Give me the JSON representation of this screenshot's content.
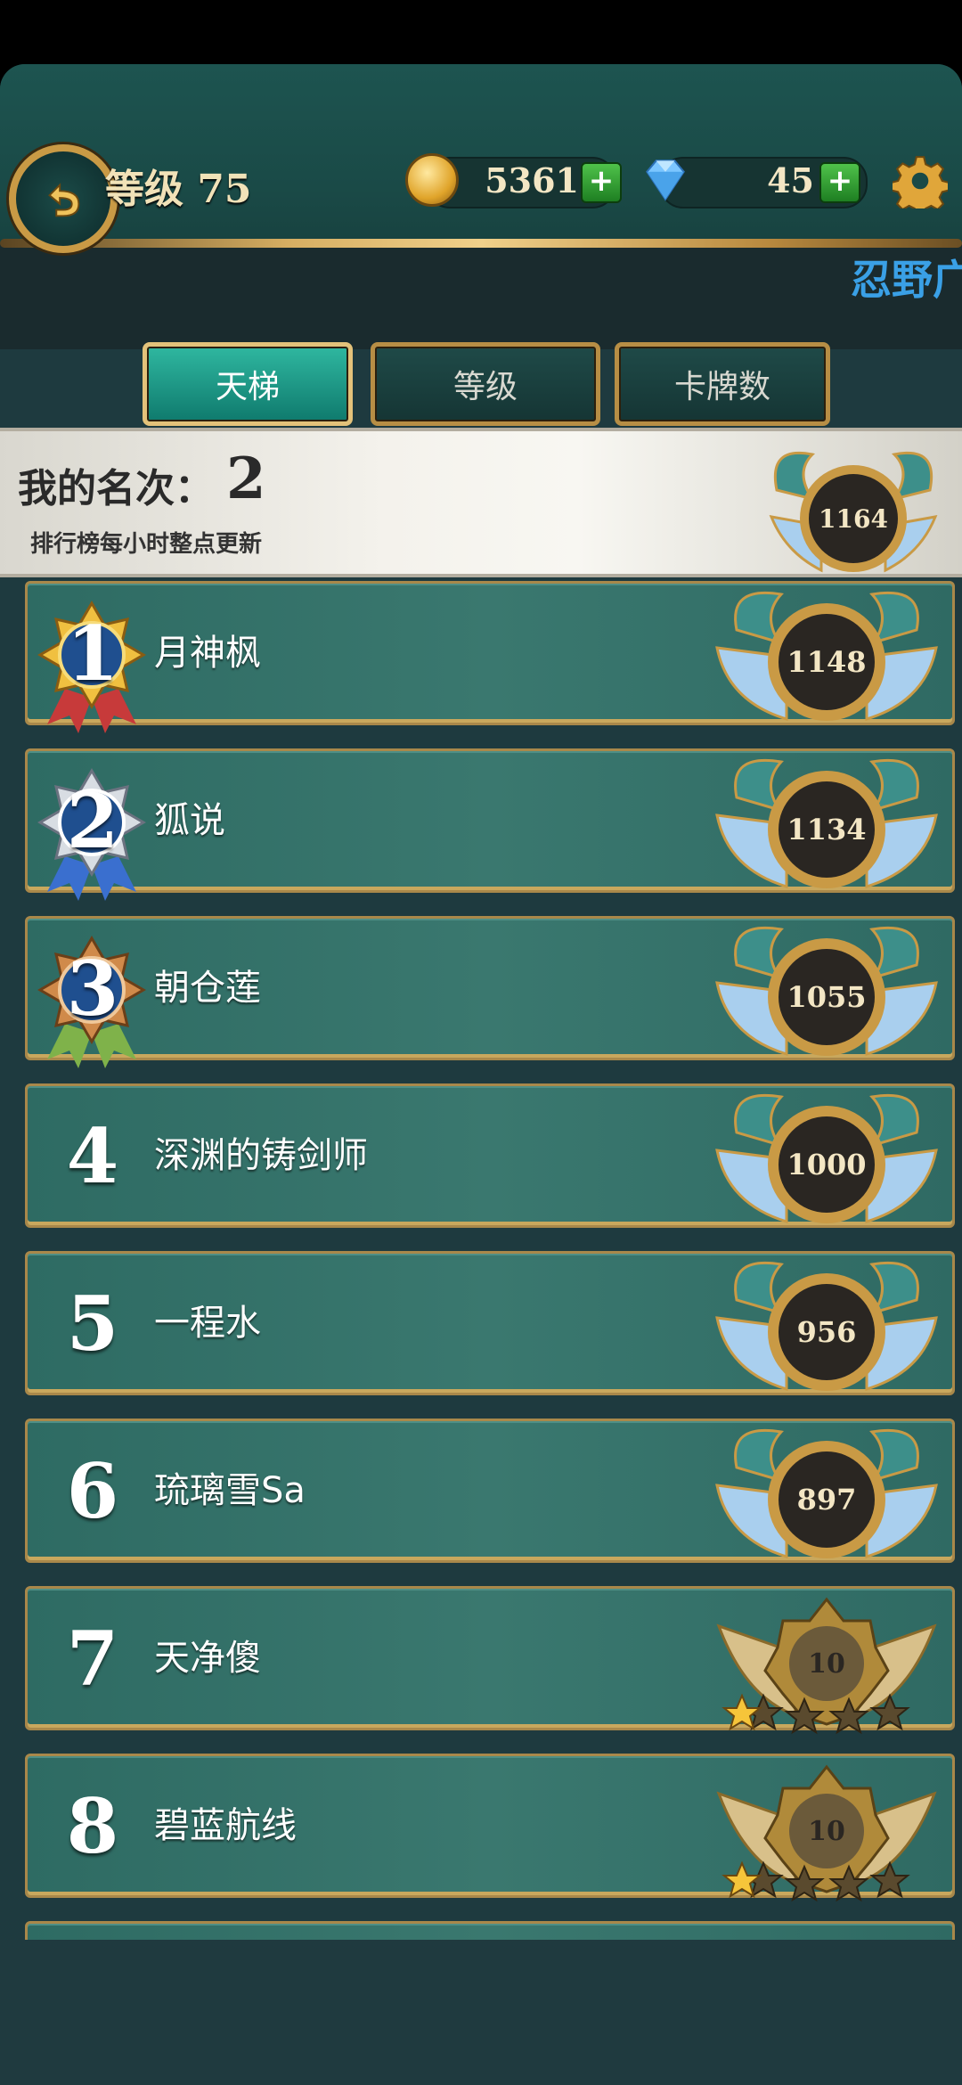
{
  "header": {
    "level_text": "等级 75",
    "coins": "5361",
    "gems": "45",
    "ticker": "忍野广"
  },
  "tabs": [
    {
      "label": "天梯",
      "active": true
    },
    {
      "label": "等级",
      "active": false
    },
    {
      "label": "卡牌数",
      "active": false
    }
  ],
  "my_rank": {
    "label": "我的名次：",
    "value": "2",
    "note": "排行榜每小时整点更新",
    "score": "1164"
  },
  "rows": [
    {
      "rank": "1",
      "name": "月神枫",
      "score": "1148",
      "medal": "gold-medal-icon",
      "badge": "winged-shield-badge"
    },
    {
      "rank": "2",
      "name": "狐说",
      "score": "1134",
      "medal": "silver-medal-icon",
      "badge": "winged-shield-badge"
    },
    {
      "rank": "3",
      "name": "朝仓莲",
      "score": "1055",
      "medal": "bronze-medal-icon",
      "badge": "winged-shield-badge"
    },
    {
      "rank": "4",
      "name": "深渊的铸剑师",
      "score": "1000",
      "badge": "winged-shield-badge"
    },
    {
      "rank": "5",
      "name": "一程水",
      "score": "956",
      "badge": "winged-shield-badge"
    },
    {
      "rank": "6",
      "name": "琉璃雪Sa",
      "score": "897",
      "badge": "winged-shield-badge"
    },
    {
      "rank": "7",
      "name": "天净傻",
      "score": "10",
      "badge": "gold-wing-star-badge"
    },
    {
      "rank": "8",
      "name": "碧蓝航线",
      "score": "10",
      "badge": "gold-wing-star-badge"
    }
  ],
  "colors": {
    "accent_teal": "#2fb7a0",
    "gold": "#c99a45",
    "row_bg": "#3a786f",
    "ticker_blue": "#3aa0e6"
  }
}
